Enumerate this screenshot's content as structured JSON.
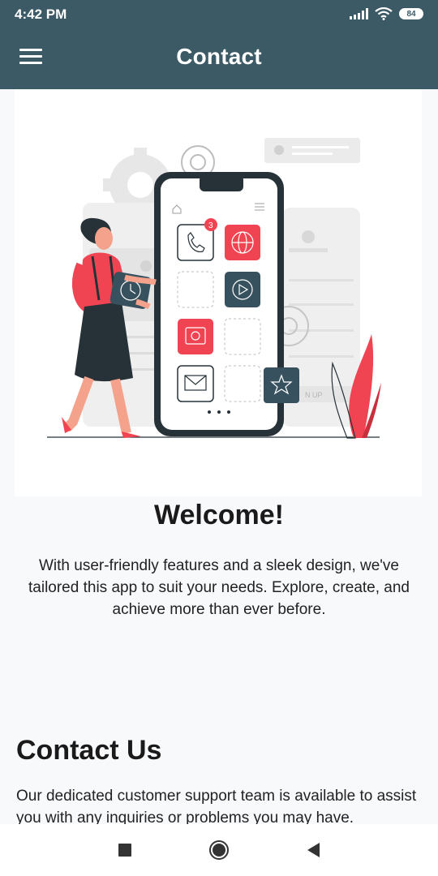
{
  "status_bar": {
    "time": "4:42 PM",
    "battery": "84",
    "icons": [
      "signal-icon",
      "wifi-icon",
      "battery-icon"
    ]
  },
  "app_bar": {
    "title": "Contact",
    "menu_icon": "hamburger-menu-icon"
  },
  "hero": {
    "illustration": "woman-holding-phone-with-app-icons",
    "badge_count": "3",
    "partial_button_text": "N UP",
    "accent_color": "#f04452",
    "dark_color": "#263238"
  },
  "welcome": {
    "heading": "Welcome!",
    "body": "With user-friendly features and a sleek design, we've tailored this app to suit your needs. Explore, create, and achieve more than ever before."
  },
  "contact": {
    "heading": "Contact Us",
    "body": "Our dedicated customer support team is available to assist you with any inquiries or problems you may have."
  },
  "nav_bar": {
    "buttons": [
      "recents-square-icon",
      "home-circle-icon",
      "back-triangle-icon"
    ]
  },
  "colors": {
    "app_bar": "#3c5a66",
    "background": "#f8f9fb",
    "text": "#1a1a1a"
  }
}
